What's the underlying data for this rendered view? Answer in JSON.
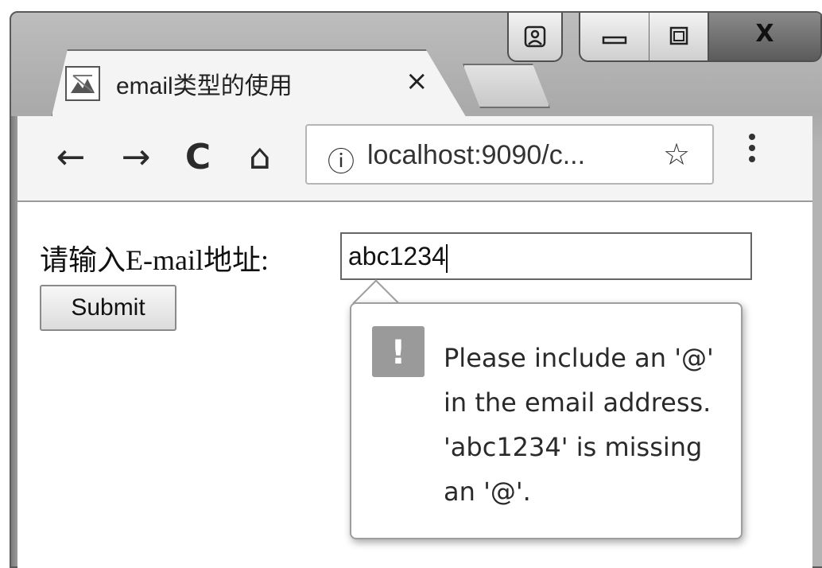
{
  "window": {
    "controls": {
      "user_icon": "user-icon",
      "minimize_icon": "minimize-icon",
      "maximize_icon": "maximize-icon",
      "close_label": "X"
    }
  },
  "tab": {
    "title": "email类型的使用",
    "close_label": "×",
    "favicon": "image-favicon-icon"
  },
  "toolbar": {
    "back_label": "←",
    "forward_label": "→",
    "reload_label": "C",
    "home_label": "⌂",
    "info_label": "ⓘ",
    "url": "localhost:9090/c...",
    "star_label": "☆",
    "menu_label": "⋮"
  },
  "page": {
    "field_label": "请输入E-mail地址:",
    "email_value": "abc1234",
    "submit_label": "Submit"
  },
  "validation": {
    "icon_label": "!",
    "message": "Please include an '@' in the email address. 'abc1234' is missing an '@'."
  }
}
